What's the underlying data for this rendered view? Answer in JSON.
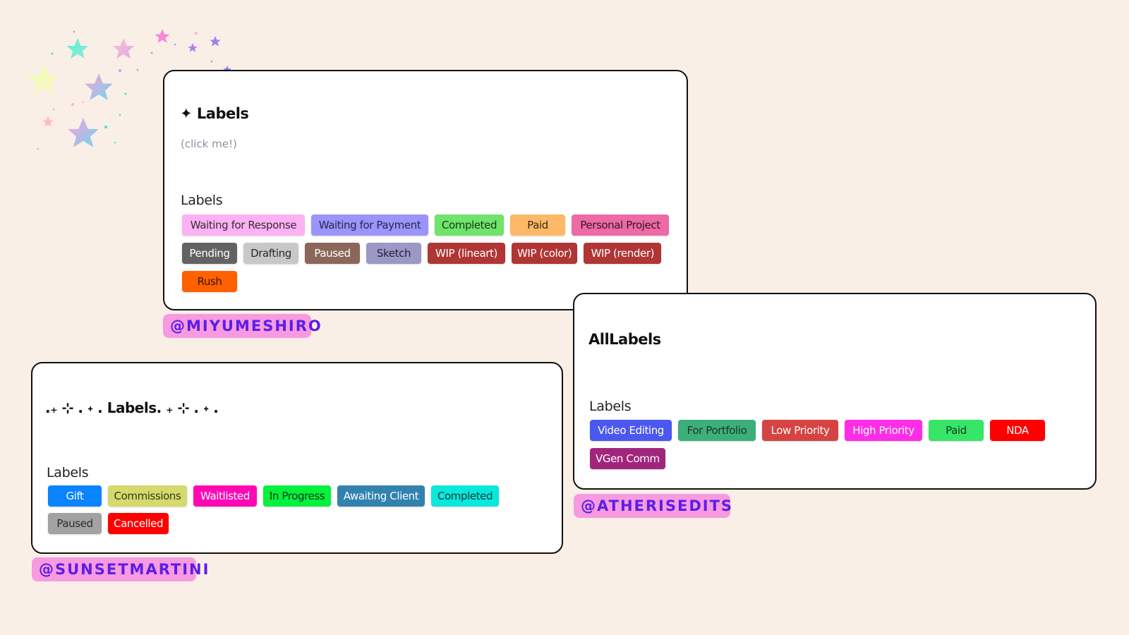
{
  "cards": [
    {
      "title": "✦ Labels",
      "subtitle": "(click me!)",
      "section_label": "Labels",
      "tags": [
        {
          "label": "Waiting for Response",
          "bg": "#fcb2f2",
          "fg": "#3a2a3a"
        },
        {
          "label": "Waiting for Payment",
          "bg": "#9b94fb",
          "fg": "#2a2550"
        },
        {
          "label": "Completed",
          "bg": "#6ee46b",
          "fg": "#1d3a1d"
        },
        {
          "label": "Paid",
          "bg": "#fdb968",
          "fg": "#3a2a15"
        },
        {
          "label": "Personal Project",
          "bg": "#ec6aa5",
          "fg": "#3a1428"
        },
        {
          "label": "Pending",
          "bg": "#636363",
          "fg": "#ffffff"
        },
        {
          "label": "Drafting",
          "bg": "#c8c8c8",
          "fg": "#2a2a2a"
        },
        {
          "label": "Paused",
          "bg": "#8a6759",
          "fg": "#ffffff"
        },
        {
          "label": "Sketch",
          "bg": "#9b98c6",
          "fg": "#222240"
        },
        {
          "label": "WIP (lineart)",
          "bg": "#b03535",
          "fg": "#ffffff"
        },
        {
          "label": "WIP (color)",
          "bg": "#b03535",
          "fg": "#ffffff"
        },
        {
          "label": "WIP (render)",
          "bg": "#b03535",
          "fg": "#ffffff"
        },
        {
          "label": "Rush",
          "bg": "#ff6000",
          "fg": "#3a1800"
        }
      ],
      "handle": "@MIYUMESHIRO"
    },
    {
      "title": ".₊ ⊹ . ˖ . Labels. ₊ ⊹ . ˖ .",
      "section_label": "Labels",
      "tags": [
        {
          "label": "Gift",
          "bg": "#0a84ff",
          "fg": "#ffffff"
        },
        {
          "label": "Commissions",
          "bg": "#d4da6c",
          "fg": "#3a3a15"
        },
        {
          "label": "Waitlisted",
          "bg": "#ff08b4",
          "fg": "#ffffff"
        },
        {
          "label": "In Progress",
          "bg": "#06f03e",
          "fg": "#0c3a15"
        },
        {
          "label": "Awaiting Client",
          "bg": "#3282b0",
          "fg": "#ffffff"
        },
        {
          "label": "Completed",
          "bg": "#08e8dc",
          "fg": "#0c3a3a"
        },
        {
          "label": "Paused",
          "bg": "#a2a2a2",
          "fg": "#2a2a2a"
        },
        {
          "label": "Cancelled",
          "bg": "#ff0000",
          "fg": "#ffffff"
        }
      ],
      "handle": "@SUNSETMARTINI"
    },
    {
      "title": "AllLabels",
      "section_label": "Labels",
      "tags": [
        {
          "label": "Video Editing",
          "bg": "#4b58ef",
          "fg": "#ffffff"
        },
        {
          "label": "For Portfolio",
          "bg": "#3daf7a",
          "fg": "#123a25"
        },
        {
          "label": "Low Priority",
          "bg": "#d54343",
          "fg": "#ffffff"
        },
        {
          "label": "High Priority",
          "bg": "#ff2ce8",
          "fg": "#ffffff"
        },
        {
          "label": "Paid",
          "bg": "#37e567",
          "fg": "#123a1d"
        },
        {
          "label": "NDA",
          "bg": "#ff0000",
          "fg": "#ffffff"
        },
        {
          "label": "VGen Comm",
          "bg": "#a0267c",
          "fg": "#ffffff"
        }
      ],
      "handle": "@ATHERISEDITS"
    }
  ],
  "decoration": {
    "icon": "stars-cluster-icon"
  }
}
